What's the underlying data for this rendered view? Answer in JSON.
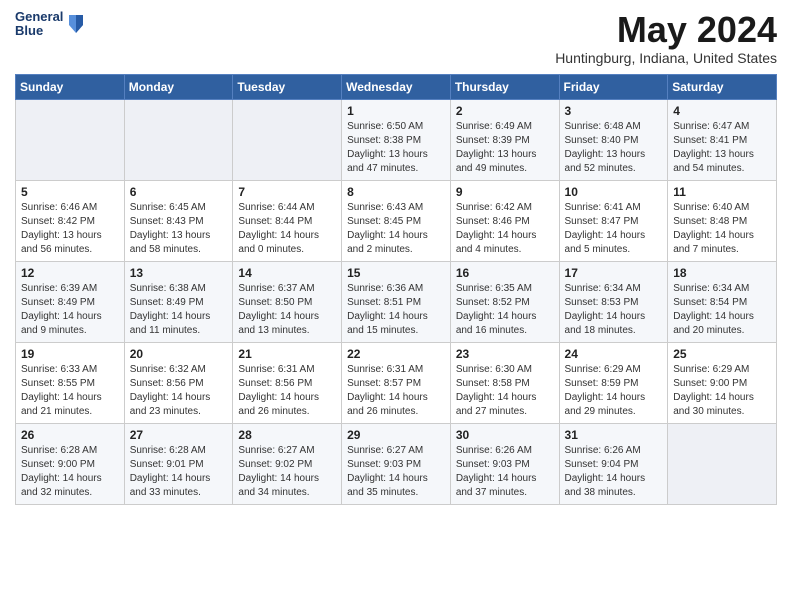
{
  "header": {
    "logo_line1": "General",
    "logo_line2": "Blue",
    "month_title": "May 2024",
    "location": "Huntingburg, Indiana, United States"
  },
  "days_of_week": [
    "Sunday",
    "Monday",
    "Tuesday",
    "Wednesday",
    "Thursday",
    "Friday",
    "Saturday"
  ],
  "weeks": [
    [
      {
        "day": "",
        "info": ""
      },
      {
        "day": "",
        "info": ""
      },
      {
        "day": "",
        "info": ""
      },
      {
        "day": "1",
        "info": "Sunrise: 6:50 AM\nSunset: 8:38 PM\nDaylight: 13 hours\nand 47 minutes."
      },
      {
        "day": "2",
        "info": "Sunrise: 6:49 AM\nSunset: 8:39 PM\nDaylight: 13 hours\nand 49 minutes."
      },
      {
        "day": "3",
        "info": "Sunrise: 6:48 AM\nSunset: 8:40 PM\nDaylight: 13 hours\nand 52 minutes."
      },
      {
        "day": "4",
        "info": "Sunrise: 6:47 AM\nSunset: 8:41 PM\nDaylight: 13 hours\nand 54 minutes."
      }
    ],
    [
      {
        "day": "5",
        "info": "Sunrise: 6:46 AM\nSunset: 8:42 PM\nDaylight: 13 hours\nand 56 minutes."
      },
      {
        "day": "6",
        "info": "Sunrise: 6:45 AM\nSunset: 8:43 PM\nDaylight: 13 hours\nand 58 minutes."
      },
      {
        "day": "7",
        "info": "Sunrise: 6:44 AM\nSunset: 8:44 PM\nDaylight: 14 hours\nand 0 minutes."
      },
      {
        "day": "8",
        "info": "Sunrise: 6:43 AM\nSunset: 8:45 PM\nDaylight: 14 hours\nand 2 minutes."
      },
      {
        "day": "9",
        "info": "Sunrise: 6:42 AM\nSunset: 8:46 PM\nDaylight: 14 hours\nand 4 minutes."
      },
      {
        "day": "10",
        "info": "Sunrise: 6:41 AM\nSunset: 8:47 PM\nDaylight: 14 hours\nand 5 minutes."
      },
      {
        "day": "11",
        "info": "Sunrise: 6:40 AM\nSunset: 8:48 PM\nDaylight: 14 hours\nand 7 minutes."
      }
    ],
    [
      {
        "day": "12",
        "info": "Sunrise: 6:39 AM\nSunset: 8:49 PM\nDaylight: 14 hours\nand 9 minutes."
      },
      {
        "day": "13",
        "info": "Sunrise: 6:38 AM\nSunset: 8:49 PM\nDaylight: 14 hours\nand 11 minutes."
      },
      {
        "day": "14",
        "info": "Sunrise: 6:37 AM\nSunset: 8:50 PM\nDaylight: 14 hours\nand 13 minutes."
      },
      {
        "day": "15",
        "info": "Sunrise: 6:36 AM\nSunset: 8:51 PM\nDaylight: 14 hours\nand 15 minutes."
      },
      {
        "day": "16",
        "info": "Sunrise: 6:35 AM\nSunset: 8:52 PM\nDaylight: 14 hours\nand 16 minutes."
      },
      {
        "day": "17",
        "info": "Sunrise: 6:34 AM\nSunset: 8:53 PM\nDaylight: 14 hours\nand 18 minutes."
      },
      {
        "day": "18",
        "info": "Sunrise: 6:34 AM\nSunset: 8:54 PM\nDaylight: 14 hours\nand 20 minutes."
      }
    ],
    [
      {
        "day": "19",
        "info": "Sunrise: 6:33 AM\nSunset: 8:55 PM\nDaylight: 14 hours\nand 21 minutes."
      },
      {
        "day": "20",
        "info": "Sunrise: 6:32 AM\nSunset: 8:56 PM\nDaylight: 14 hours\nand 23 minutes."
      },
      {
        "day": "21",
        "info": "Sunrise: 6:31 AM\nSunset: 8:56 PM\nDaylight: 14 hours\nand 26 minutes."
      },
      {
        "day": "22",
        "info": "Sunrise: 6:31 AM\nSunset: 8:57 PM\nDaylight: 14 hours\nand 26 minutes."
      },
      {
        "day": "23",
        "info": "Sunrise: 6:30 AM\nSunset: 8:58 PM\nDaylight: 14 hours\nand 27 minutes."
      },
      {
        "day": "24",
        "info": "Sunrise: 6:29 AM\nSunset: 8:59 PM\nDaylight: 14 hours\nand 29 minutes."
      },
      {
        "day": "25",
        "info": "Sunrise: 6:29 AM\nSunset: 9:00 PM\nDaylight: 14 hours\nand 30 minutes."
      }
    ],
    [
      {
        "day": "26",
        "info": "Sunrise: 6:28 AM\nSunset: 9:00 PM\nDaylight: 14 hours\nand 32 minutes."
      },
      {
        "day": "27",
        "info": "Sunrise: 6:28 AM\nSunset: 9:01 PM\nDaylight: 14 hours\nand 33 minutes."
      },
      {
        "day": "28",
        "info": "Sunrise: 6:27 AM\nSunset: 9:02 PM\nDaylight: 14 hours\nand 34 minutes."
      },
      {
        "day": "29",
        "info": "Sunrise: 6:27 AM\nSunset: 9:03 PM\nDaylight: 14 hours\nand 35 minutes."
      },
      {
        "day": "30",
        "info": "Sunrise: 6:26 AM\nSunset: 9:03 PM\nDaylight: 14 hours\nand 37 minutes."
      },
      {
        "day": "31",
        "info": "Sunrise: 6:26 AM\nSunset: 9:04 PM\nDaylight: 14 hours\nand 38 minutes."
      },
      {
        "day": "",
        "info": ""
      }
    ]
  ]
}
